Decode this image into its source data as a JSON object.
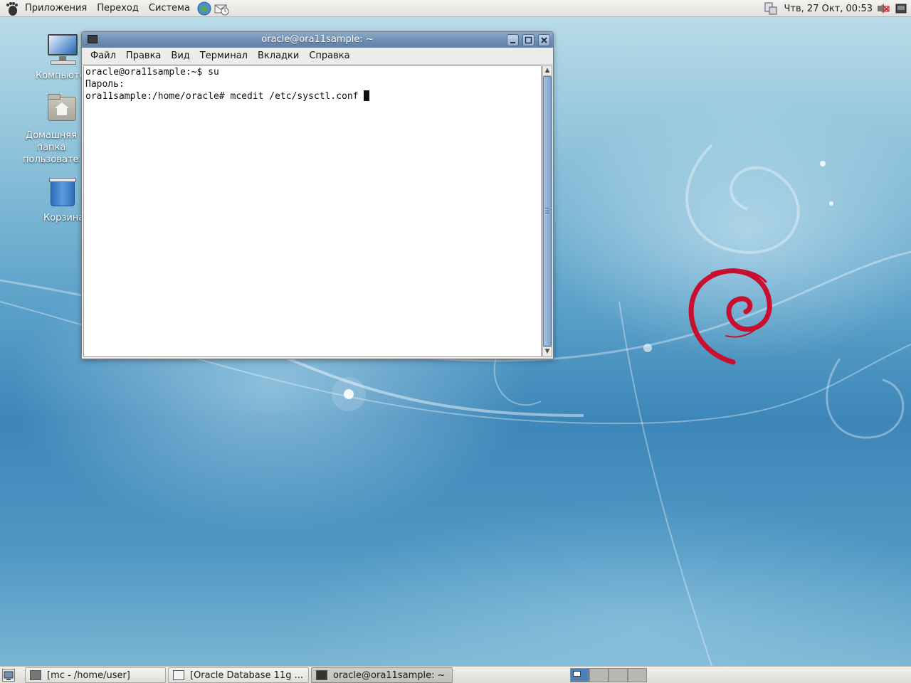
{
  "top_panel": {
    "menu": [
      "Приложения",
      "Переход",
      "Система"
    ],
    "clock": "Чтв, 27 Окт, 00:53"
  },
  "desktop": {
    "icons": [
      {
        "label": "Компьютер"
      },
      {
        "label": "Домашняя папка пользователя oracle"
      },
      {
        "label": "Корзина"
      }
    ]
  },
  "terminal": {
    "title": "oracle@ora11sample: ~",
    "menu": [
      "Файл",
      "Правка",
      "Вид",
      "Терминал",
      "Вкладки",
      "Справка"
    ],
    "lines": [
      "oracle@ora11sample:~$ su",
      "Пароль:",
      "ora11sample:/home/oracle# mcedit /etc/sysctl.conf "
    ]
  },
  "taskbar": {
    "tasks": [
      {
        "label": "[mc - /home/user]"
      },
      {
        "label": "[Oracle Database 11g ..."
      },
      {
        "label": "oracle@ora11sample: ~"
      }
    ]
  },
  "colors": {
    "titlebar": "#6f8fb3",
    "debian_swirl": "#c8102e",
    "panel": "#e9e8e4"
  }
}
